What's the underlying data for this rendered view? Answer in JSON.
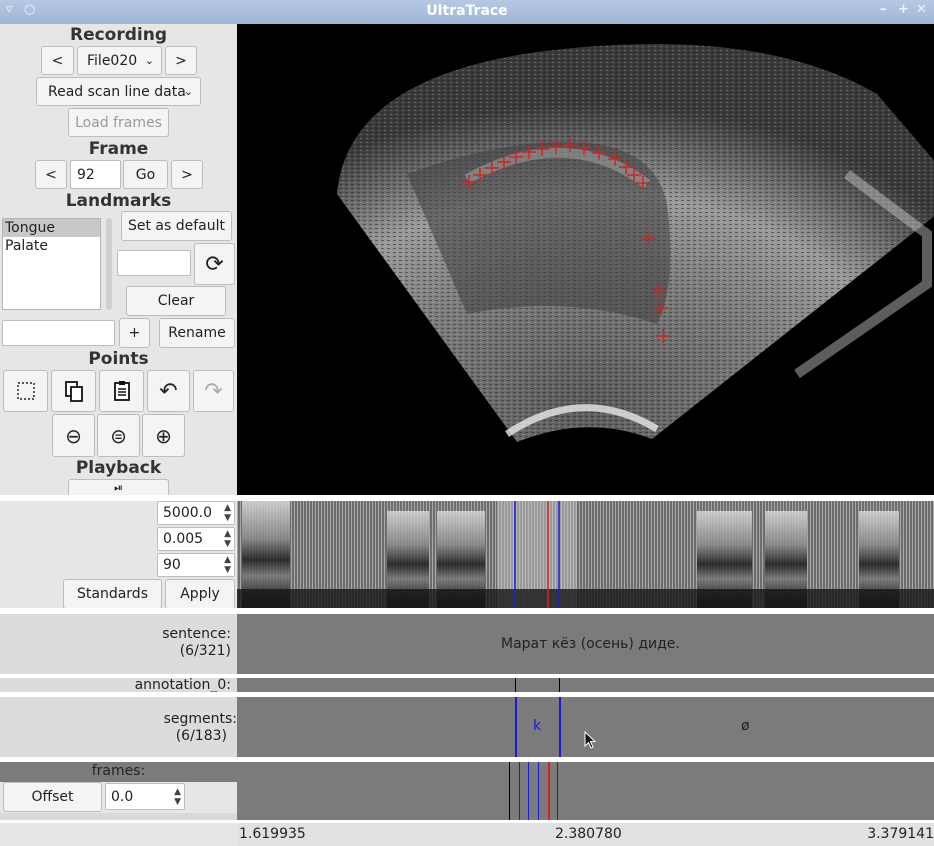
{
  "window": {
    "title": "UltraTrace",
    "left_icons": [
      "menu-icon",
      "pin-icon"
    ],
    "right_icons": [
      "minimize-icon",
      "maximize-icon",
      "close-icon"
    ]
  },
  "recording": {
    "header": "Recording",
    "prev_label": "<",
    "file_value": "File020",
    "next_label": ">",
    "scan_option": "Read scan line data",
    "load_frames_label": "Load frames"
  },
  "frame": {
    "header": "Frame",
    "prev_label": "<",
    "value": "92",
    "go_label": "Go",
    "next_label": ">"
  },
  "landmarks": {
    "header": "Landmarks",
    "items": [
      "Tongue",
      "Palate"
    ],
    "selected": "Tongue",
    "set_default_label": "Set as default",
    "color_value": "",
    "clear_label": "Clear",
    "new_name_value": "",
    "add_label": "+",
    "rename_label": "Rename"
  },
  "points": {
    "header": "Points",
    "tools": [
      "select-icon",
      "copy-icon",
      "paste-icon",
      "undo-icon",
      "redo-icon"
    ],
    "zoom": [
      "zoom-out-icon",
      "zoom-reset-icon",
      "zoom-in-icon"
    ]
  },
  "playback": {
    "header": "Playback"
  },
  "spectrogram_settings": {
    "max_freq": "5000.0",
    "window_length": "0.005",
    "dynamic_range": "90",
    "standards_label": "Standards",
    "apply_label": "Apply"
  },
  "tiers": {
    "sentence": {
      "label": "sentence:",
      "count": "(6/321)",
      "text": "Марат кёз (осень) диде."
    },
    "annotation": {
      "label": "annotation_0:"
    },
    "segments": {
      "label": "segments:",
      "count": "(6/183)",
      "seg1": "k",
      "seg2": "ø"
    },
    "frames": {
      "label": "frames:",
      "offset_label": "Offset",
      "offset_value": "0.0"
    }
  },
  "timeline": {
    "start": "1.619935",
    "current": "2.380780",
    "end": "3.379141"
  },
  "colors": {
    "cursor_red": "#d42020",
    "boundary_blue": "#1a1adc",
    "title_bar": "#a9bedc"
  }
}
